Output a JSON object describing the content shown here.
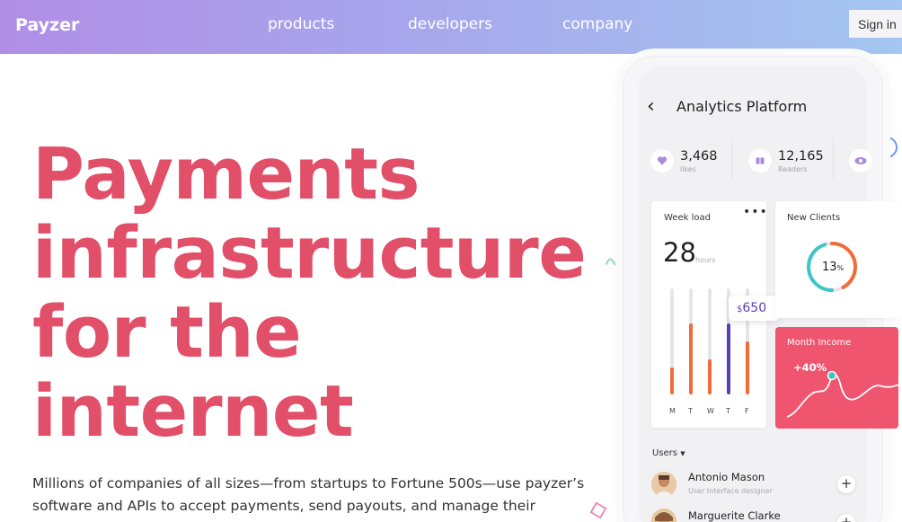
{
  "header": {
    "logo": "Payzer",
    "nav": [
      "products",
      "developers",
      "company"
    ],
    "signin_label": "Sign in"
  },
  "hero": {
    "title_lines": [
      "Payments",
      "infrastructure",
      "for the",
      "internet"
    ],
    "copy_lines": [
      "Millions of companies of all sizes—from startups to Fortune 500s—use payzer’s",
      "software and APIs to accept payments, send payouts, and manage their"
    ]
  },
  "phone": {
    "title": "Analytics Platform",
    "back_icon": "chevron-left-icon",
    "stats": [
      {
        "icon": "heart-icon",
        "value": "3,468",
        "label": "likes"
      },
      {
        "icon": "book-icon",
        "value": "12,165",
        "label": "Readers"
      },
      {
        "icon": "eye-icon",
        "value": "",
        "label": ""
      }
    ],
    "week_load": {
      "title": "Week load",
      "menu_icon": "more-horizontal-icon",
      "value": "28",
      "unit": "hours",
      "days": [
        "M",
        "T",
        "W",
        "T",
        "F"
      ],
      "fill_fractions": [
        0.25,
        0.67,
        0.33,
        0.67,
        0.5
      ],
      "highlight_index": 3,
      "tooltip_currency": "$",
      "tooltip_value": "650"
    },
    "new_clients": {
      "title": "New Clients",
      "value": "13",
      "unit": "%",
      "fraction": 0.13
    },
    "month_income": {
      "title": "Month Income",
      "change": "+40%"
    },
    "users": {
      "label": "Users",
      "dropdown_icon": "caret-down-icon",
      "list": [
        {
          "name": "Antonio Mason",
          "role": "User Interface designer"
        },
        {
          "name": "Marguerite Clarke",
          "role": ""
        }
      ]
    }
  },
  "colors": {
    "accent": "#e14f68",
    "orange": "#f26b3a",
    "purple": "#5b3fb9",
    "teal": "#3ec5c5",
    "income": "#f05570"
  }
}
